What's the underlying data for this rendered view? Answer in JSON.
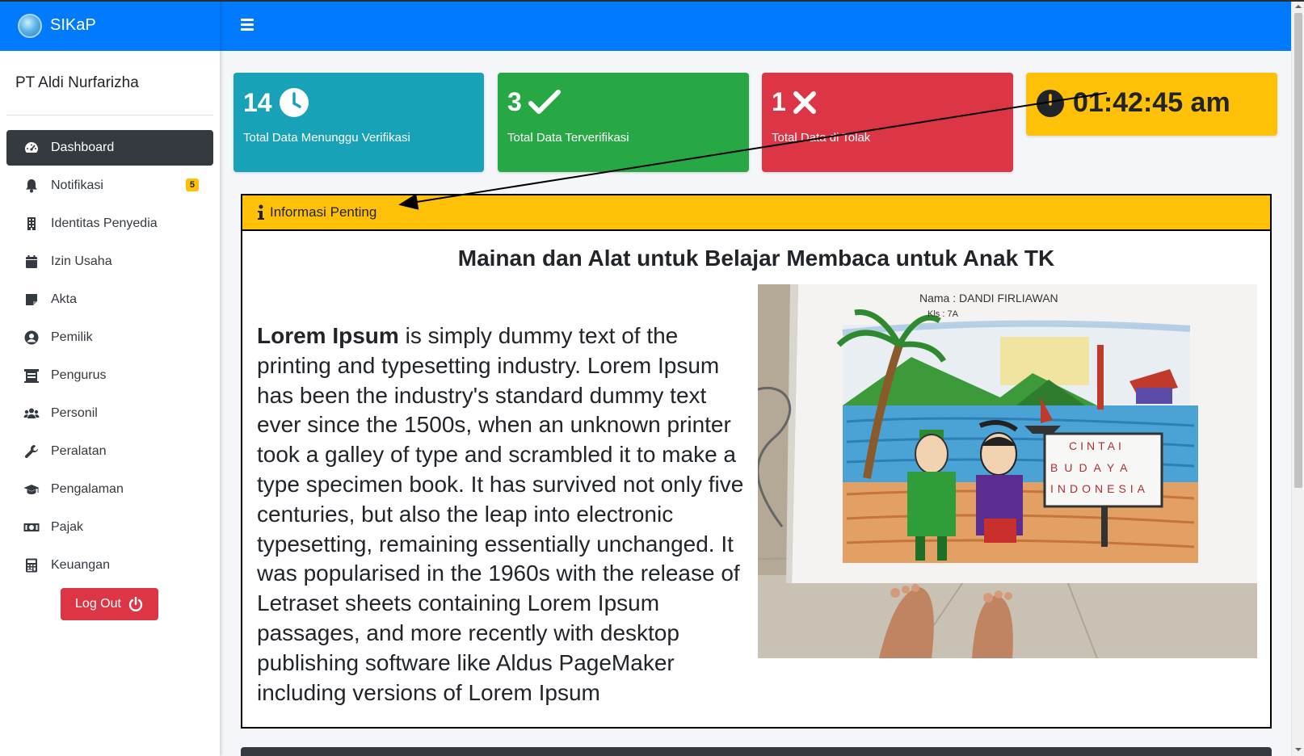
{
  "app": {
    "title": "SIKaP"
  },
  "sidebar": {
    "company": "PT Aldi Nurfarizha",
    "items": [
      {
        "label": "Dashboard",
        "icon": "dashboard-icon",
        "active": true
      },
      {
        "label": "Notifikasi",
        "icon": "bell-icon",
        "badge": "5"
      },
      {
        "label": "Identitas Penyedia",
        "icon": "building-icon"
      },
      {
        "label": "Izin Usaha",
        "icon": "calendar-icon"
      },
      {
        "label": "Akta",
        "icon": "sticky-note-icon"
      },
      {
        "label": "Pemilik",
        "icon": "user-circle-icon"
      },
      {
        "label": "Pengurus",
        "icon": "org-chart-icon"
      },
      {
        "label": "Personil",
        "icon": "users-icon"
      },
      {
        "label": "Peralatan",
        "icon": "wrench-icon"
      },
      {
        "label": "Pengalaman",
        "icon": "graduation-cap-icon"
      },
      {
        "label": "Pajak",
        "icon": "money-bill-icon"
      },
      {
        "label": "Keuangan",
        "icon": "calculator-icon"
      }
    ],
    "logout_label": "Log Out"
  },
  "stats": {
    "waiting": {
      "value": "14",
      "label": "Total Data Menunggu Verifikasi",
      "color": "#17a2b8"
    },
    "verified": {
      "value": "3",
      "label": "Total Data Terverifikasi",
      "color": "#28a745"
    },
    "rejected": {
      "value": "1",
      "label": "Total Data di Tolak",
      "color": "#dc3545"
    },
    "clock": {
      "value": "01:42:45 am",
      "color": "#ffc107"
    }
  },
  "info": {
    "header": "Informasi Penting",
    "title": "Mainan dan Alat untuk Belajar Membaca untuk Anak TK",
    "body_bold": "Lorem Ipsum",
    "body": " is simply dummy text of the printing and typesetting industry. Lorem Ipsum has been the industry's standard dummy text ever since the 1500s, when an unknown printer took a galley of type and scrambled it to make a type specimen book. It has survived not only five centuries, but also the leap into electronic typesetting, remaining essentially unchanged. It was popularised in the 1960s with the release of Letraset sheets containing Lorem Ipsum passages, and more recently with desktop publishing software like Aldus PageMaker including versions of Lorem Ipsum",
    "image": {
      "name_text": "Nama : DANDI FIRLIAWAN",
      "class_text": "Kls : 7A",
      "sign_lines": [
        "CINTAI",
        "BUDAYA",
        "INDONESIA"
      ]
    }
  },
  "colors": {
    "primary": "#007bff",
    "dark": "#343a40",
    "warning": "#ffc107"
  }
}
